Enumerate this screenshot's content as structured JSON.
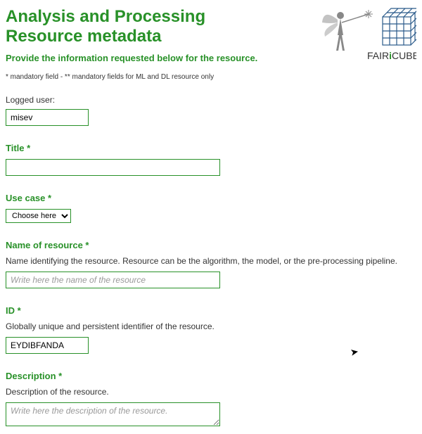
{
  "header": {
    "title": "Analysis and Processing Resource metadata",
    "subtitle": "Provide the information requested below for the resource.",
    "note": "* mandatory field - ** mandatory fields for ML and DL resource only",
    "logo_text": "FAIRiCUBE"
  },
  "logged_user": {
    "label": "Logged user:",
    "value": "misev"
  },
  "title_field": {
    "label": "Title *",
    "value": ""
  },
  "use_case": {
    "label": "Use case *",
    "selected": "Choose here"
  },
  "name_resource": {
    "label": "Name of resource *",
    "hint": "Name identifying the resource. Resource can be the algorithm, the model, or the pre-processing pipeline.",
    "placeholder": "Write here the name of the resource",
    "value": ""
  },
  "id_field": {
    "label": "ID *",
    "hint": "Globally unique and persistent identifier of the resource.",
    "value": "EYDIBFANDA"
  },
  "description": {
    "label": "Description *",
    "hint": "Description of the resource.",
    "placeholder": "Write here the description of the resource.",
    "value": ""
  }
}
